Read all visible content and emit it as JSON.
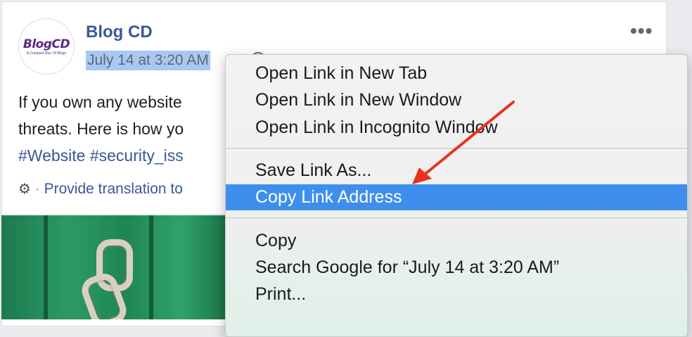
{
  "post": {
    "page_name": "Blog CD",
    "timestamp": "July 14 at 3:20 AM",
    "more_label": "•••",
    "avatar_logo": "BlogCD",
    "avatar_tagline": "A Compact Disc Of Blogs",
    "text_line1": "If you own any website",
    "text_line2": "threats. Here is how yo",
    "hashtags": "#Website #security_iss",
    "translate_sep": "·",
    "translate_label": "Provide translation to"
  },
  "context_menu": {
    "group1": [
      "Open Link in New Tab",
      "Open Link in New Window",
      "Open Link in Incognito Window"
    ],
    "group2": [
      "Save Link As...",
      "Copy Link Address"
    ],
    "group3": [
      "Copy",
      "Search Google for “July 14 at 3:20 AM”",
      "Print..."
    ],
    "highlighted_item": "Copy Link Address"
  },
  "colors": {
    "link_blue": "#385898",
    "menu_highlight": "#3e8fed",
    "timestamp_selection": "#a8c8f4",
    "arrow_red": "#e8321d"
  },
  "icons": [
    "globe-icon",
    "more-options-icon",
    "gear-icon",
    "red-arrow-annotation"
  ]
}
